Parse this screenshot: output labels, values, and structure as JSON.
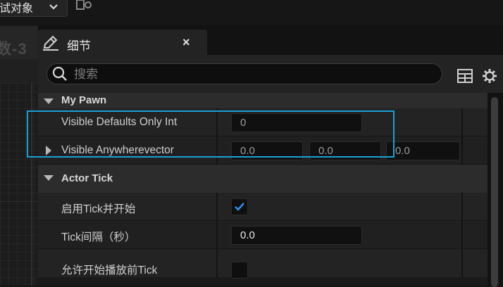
{
  "top": {
    "dropdown_label": "试对象"
  },
  "left": {
    "label": "数-3"
  },
  "panel": {
    "tab_title": "细节",
    "close_symbol": "×",
    "search_placeholder": "搜索"
  },
  "categories": [
    {
      "label": "My Pawn",
      "rows": [
        {
          "label": "Visible Defaults Only Int",
          "value": "0"
        },
        {
          "label": "Visible Anywherevector",
          "values": [
            "0.0",
            "0.0",
            "0.0"
          ]
        }
      ]
    },
    {
      "label": "Actor Tick",
      "rows": [
        {
          "label": "启用Tick并开始",
          "checked": true
        },
        {
          "label": "Tick间隔（秒）",
          "value": "0.0"
        },
        {
          "label": "允许开始播放前Tick",
          "checked": false
        }
      ]
    }
  ],
  "icons": {
    "dropdown": "chevron-down-icon",
    "top": "search-eye-icon",
    "tab": "pencil-icon",
    "search": "search-icon",
    "view": "table-view-icon",
    "settings": "gear-icon",
    "checkbox": "checkmark-icon"
  },
  "colors": {
    "highlight": "#1aa0d8",
    "checkmark": "#2f8cf0"
  }
}
